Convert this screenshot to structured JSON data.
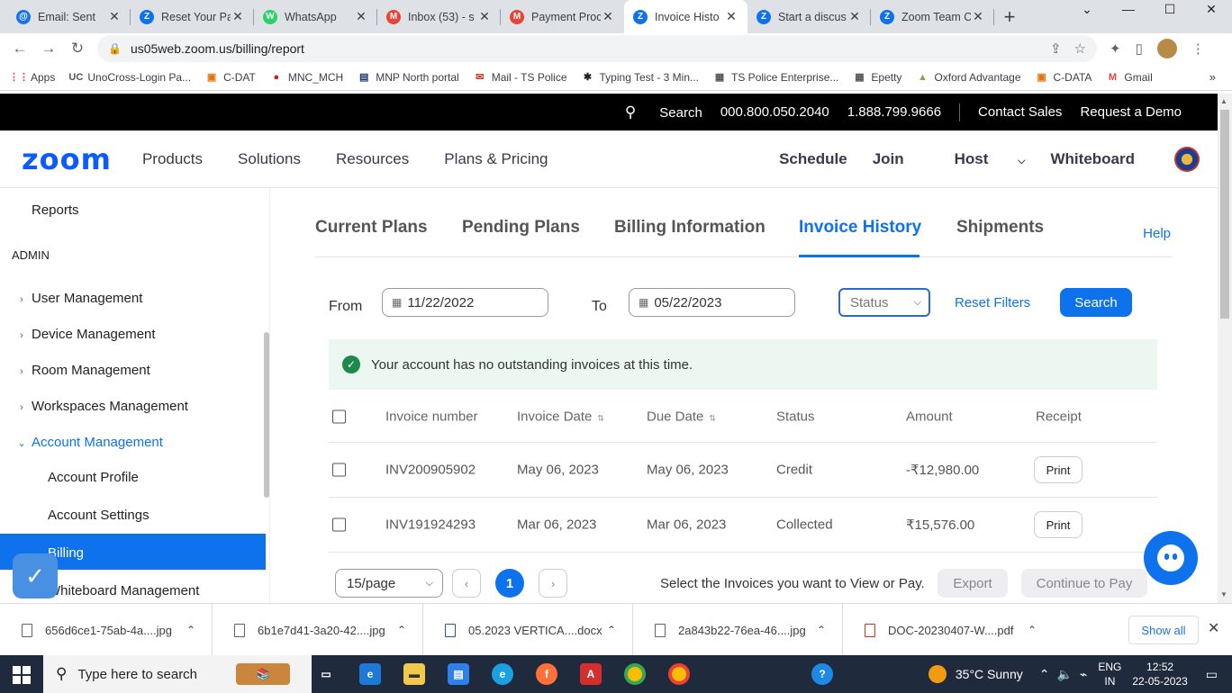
{
  "browser": {
    "tabs": [
      {
        "title": "Email: Sent",
        "color": "#1a73e8",
        "glyph": "@"
      },
      {
        "title": "Reset Your Pa",
        "color": "#0e72ed",
        "glyph": "Z"
      },
      {
        "title": "WhatsApp",
        "color": "#25d366",
        "glyph": "W"
      },
      {
        "title": "Inbox (53) - s",
        "color": "#ea4335",
        "glyph": "M"
      },
      {
        "title": "Payment Proc",
        "color": "#ea4335",
        "glyph": "M"
      },
      {
        "title": "Invoice Histo",
        "color": "#0e72ed",
        "glyph": "Z"
      },
      {
        "title": "Start a discus",
        "color": "#0e72ed",
        "glyph": "Z"
      },
      {
        "title": "Zoom Team C",
        "color": "#0e72ed",
        "glyph": "Z"
      }
    ],
    "url": "us05web.zoom.us/billing/report",
    "bookmarks": [
      {
        "label": "Apps",
        "glyph": "⋮⋮",
        "color": "#ea4335"
      },
      {
        "label": "UnoCross-Login Pa...",
        "glyph": "UC",
        "color": "#555"
      },
      {
        "label": "C-DAT",
        "glyph": "▣",
        "color": "#e8710a"
      },
      {
        "label": "MNC_MCH",
        "glyph": "●",
        "color": "#c5221f"
      },
      {
        "label": "MNP North portal",
        "glyph": "▤",
        "color": "#1a3a6b"
      },
      {
        "label": "Mail - TS Police",
        "glyph": "✉",
        "color": "#d93025"
      },
      {
        "label": "Typing Test - 3 Min...",
        "glyph": "✱",
        "color": "#222"
      },
      {
        "label": "TS Police Enterprise...",
        "glyph": "▦",
        "color": "#555"
      },
      {
        "label": "Epetty",
        "glyph": "▦",
        "color": "#555"
      },
      {
        "label": "Oxford Advantage",
        "glyph": "▲",
        "color": "#7cb342"
      },
      {
        "label": "C-DATA",
        "glyph": "▣",
        "color": "#e8710a"
      },
      {
        "label": "Gmail",
        "glyph": "M",
        "color": "#ea4335"
      }
    ]
  },
  "topbar": {
    "search": "Search",
    "phone1": "000.800.050.2040",
    "phone2": "1.888.799.9666",
    "contact": "Contact Sales",
    "demo": "Request a Demo"
  },
  "nav": {
    "logo": "zoom",
    "items": [
      "Products",
      "Solutions",
      "Resources",
      "Plans & Pricing"
    ],
    "schedule": "Schedule",
    "join": "Join",
    "host": "Host",
    "whiteboard": "Whiteboard"
  },
  "sidebar": {
    "reports": "Reports",
    "admin": "ADMIN",
    "user_mgmt": "User Management",
    "device_mgmt": "Device Management",
    "room_mgmt": "Room Management",
    "workspaces_mgmt": "Workspaces Management",
    "account_mgmt": "Account Management",
    "account_profile": "Account Profile",
    "account_settings": "Account Settings",
    "billing": "Billing",
    "whiteboard_mgmt": "Whiteboard Management"
  },
  "billing_tabs": {
    "current": "Current Plans",
    "pending": "Pending Plans",
    "info": "Billing Information",
    "invoice": "Invoice History",
    "shipments": "Shipments",
    "help": "Help"
  },
  "filters": {
    "from_label": "From",
    "from_date": "11/22/2022",
    "to_label": "To",
    "to_date": "05/22/2023",
    "status_placeholder": "Status",
    "reset": "Reset Filters",
    "search": "Search"
  },
  "notice": "Your account has no outstanding invoices at this time.",
  "table": {
    "headers": {
      "number": "Invoice number",
      "invoice_date": "Invoice Date",
      "due_date": "Due Date",
      "status": "Status",
      "amount": "Amount",
      "receipt": "Receipt"
    },
    "rows": [
      {
        "number": "INV200905902",
        "invoice_date": "May 06, 2023",
        "due_date": "May 06, 2023",
        "status": "Credit",
        "amount": "-₹12,980.00",
        "receipt": "Print"
      },
      {
        "number": "INV191924293",
        "invoice_date": "Mar 06, 2023",
        "due_date": "Mar 06, 2023",
        "status": "Collected",
        "amount": "₹15,576.00",
        "receipt": "Print"
      }
    ]
  },
  "pager": {
    "per_page": "15/page",
    "current_page": "1",
    "hint": "Select the Invoices you want to View or Pay.",
    "export": "Export",
    "continue": "Continue to Pay"
  },
  "downloads": {
    "files": [
      "656d6ce1-75ab-4a....jpg",
      "6b1e7d41-3a20-42....jpg",
      "05.2023 VERTICA....docx",
      "2a843b22-76ea-46....jpg",
      "DOC-20230407-W....pdf"
    ],
    "show_all": "Show all"
  },
  "taskbar": {
    "search_placeholder": "Type here to search",
    "weather": "35°C  Sunny",
    "lang1": "ENG",
    "lang2": "IN",
    "time": "12:52",
    "date": "22-05-2023"
  },
  "colors": {
    "accent": "#0e72ed",
    "topbar": "#000000"
  }
}
